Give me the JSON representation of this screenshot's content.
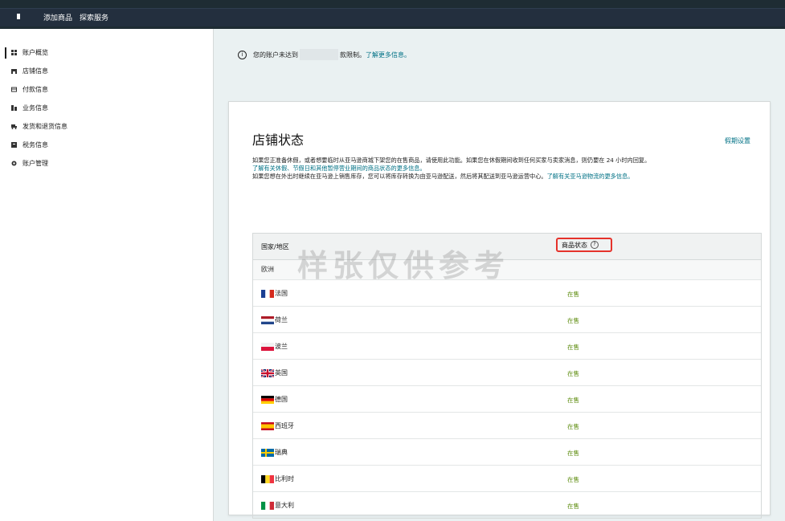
{
  "topbar": {
    "links": [
      "添加商品",
      "探索服务"
    ]
  },
  "sidebar": {
    "items": [
      {
        "label": "账户概览",
        "icon": "grid-icon"
      },
      {
        "label": "店铺信息",
        "icon": "store-icon"
      },
      {
        "label": "付款信息",
        "icon": "card-icon"
      },
      {
        "label": "业务信息",
        "icon": "briefcase-icon"
      },
      {
        "label": "发货和退货信息",
        "icon": "truck-icon"
      },
      {
        "label": "税务信息",
        "icon": "tax-icon"
      },
      {
        "label": "账户管理",
        "icon": "gear-icon"
      }
    ]
  },
  "alert": {
    "prefix": "您的账户未达到",
    "suffix": "款限制。",
    "link": "了解更多信息。"
  },
  "card": {
    "title": "店铺状态",
    "settings_link": "假期设置",
    "desc_line1": "如果您正准备休假，或者想要临时从亚马逊商城下架您的在售商品，请使用此功能。如果您在休假期间收到任何买家与卖家消息，则仍要在 24 小时内回复。",
    "desc_link1": "了解有关休假、节假日和其他暂停营业期间的商品状态的更多信息。",
    "desc_line3": "如果您想在外出时继续在亚马逊上销售库存，您可以将库存转换为由亚马逊配送，然后将其配送到亚马逊运营中心。",
    "desc_link2": "了解有关亚马逊物流的更多信息。"
  },
  "table": {
    "col_country": "国家/地区",
    "col_status": "商品状态",
    "region": "欧洲",
    "rows": [
      {
        "country": "法国",
        "status": "在售"
      },
      {
        "country": "荷兰",
        "status": "在售"
      },
      {
        "country": "波兰",
        "status": "在售"
      },
      {
        "country": "英国",
        "status": "在售"
      },
      {
        "country": "德国",
        "status": "在售"
      },
      {
        "country": "西班牙",
        "status": "在售"
      },
      {
        "country": "瑞典",
        "status": "在售"
      },
      {
        "country": "比利时",
        "status": "在售"
      },
      {
        "country": "意大利",
        "status": "在售"
      }
    ]
  },
  "watermark": "样张仅供参考",
  "colors": {
    "topbar": "#232f3e",
    "link": "#007185",
    "status": "#5a8a0a",
    "highlight": "#e5322b"
  }
}
